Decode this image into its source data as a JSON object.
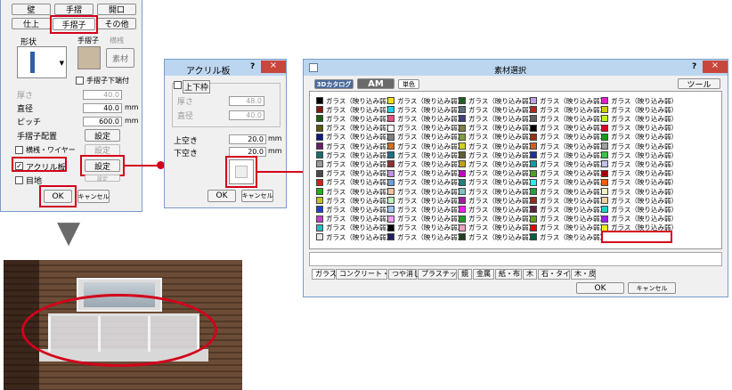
{
  "left_panel": {
    "top_buttons": [
      "壁",
      "手摺",
      "開口"
    ],
    "tabs": [
      "仕上",
      "手摺子",
      "その他"
    ],
    "shape_label": "形状",
    "tesurigo_label": "手摺子",
    "yokosan_label": "横桟",
    "material_button": "素材",
    "under_end_label": "手摺子下端付",
    "thickness_label": "厚さ",
    "thickness_value": "40.0",
    "diameter_label": "直径",
    "diameter_value": "40.0",
    "pitch_label": "ピッチ",
    "pitch_value": "600.0",
    "unit": "mm",
    "placement_label": "手摺子配置",
    "settings": "設定",
    "yokosan_wire_label": "横桟・ワイヤー",
    "acrylic_label": "アクリル板",
    "meji_label": "目地",
    "ok": "OK",
    "cancel": "キャンセル"
  },
  "arrow_down": "▼",
  "acrylic_dialog": {
    "title": "アクリル板",
    "help": "?",
    "close": "×",
    "frame_label": "上下枠",
    "thickness_label": "厚さ",
    "thickness_value": "48.0",
    "diameter_label": "直径",
    "diameter_value": "40.0",
    "top_gap_label": "上空き",
    "top_gap_value": "20.0",
    "bottom_gap_label": "下空き",
    "bottom_gap_value": "20.0",
    "unit": "mm",
    "ok": "OK",
    "cancel": "キャンセル"
  },
  "material_dialog": {
    "title": "素材選択",
    "help": "?",
    "close": "×",
    "tabs_top": [
      "3Dカタログ",
      "AM",
      "単色"
    ],
    "tool_button": "ツール",
    "columns": [
      {
        "label": "ガラス（映り込み弱）",
        "colors": [
          "#000000",
          "#7a1f12",
          "#1d5e16",
          "#5a5a14",
          "#101a7a",
          "#6a1f6a",
          "#1e6a6a",
          "#9a9a9a",
          "#4a4a4a",
          "#d22020",
          "#20b020",
          "#c0c020",
          "#2040d0",
          "#c040c0",
          "#20c0c0",
          "#e8e8e8"
        ]
      },
      {
        "label": "ガラス（映り込み弱）",
        "colors": [
          "#f0e020",
          "#20d0e8",
          "#e85080",
          "#ffffff",
          "#808080",
          "#d07020",
          "#207080",
          "#903030",
          "#c090e0",
          "#70a0d0",
          "#f0c0a0",
          "#c0f0c0",
          "#a0c0f0",
          "#f0a0f0",
          "#000000",
          "#202060"
        ]
      },
      {
        "label": "ガラス（映り込み弱）",
        "colors": [
          "#206020",
          "#607080",
          "#404080",
          "#808040",
          "#80a040",
          "#d0d020",
          "#606030",
          "#c0a020",
          "#c000c0",
          "#208080",
          "#80c0c0",
          "#a020a0",
          "#f020f0",
          "#20a020",
          "#f0a0c0",
          "#204020"
        ]
      },
      {
        "label": "ガラス（映り込み弱）",
        "colors": [
          "#c0a0e0",
          "#c02020",
          "#606060",
          "#000000",
          "#a03010",
          "#d06020",
          "#2030a0",
          "#00a0a0",
          "#50a020",
          "#20f0f0",
          "#20a040",
          "#903020",
          "#602040",
          "#60a020",
          "#f00000",
          "#006040"
        ]
      },
      {
        "label": "ガラス（映り込み弱）",
        "colors": [
          "#e020c0",
          "#d0d000",
          "#c0f020",
          "#e00020",
          "#10a010",
          "#a0a0a0",
          "#40c040",
          "#c0c0f0",
          "#a00000",
          "#f06000",
          "#f0f0c0",
          "#f0d0a0",
          "#20d0d0",
          "#a020f0",
          "#f0f020"
        ]
      }
    ],
    "bottom_tabs": [
      "ガラス",
      "コンクリート・土",
      "つや消し",
      "プラスチック",
      "鏡",
      "金属",
      "紙・布",
      "木",
      "石・タイル",
      "木・皮"
    ],
    "ok": "OK",
    "cancel": "キャンセル"
  },
  "colors": {
    "highlight": "#d4001a",
    "title_bar": "#bcd6f0",
    "close_button": "#c9463d"
  }
}
